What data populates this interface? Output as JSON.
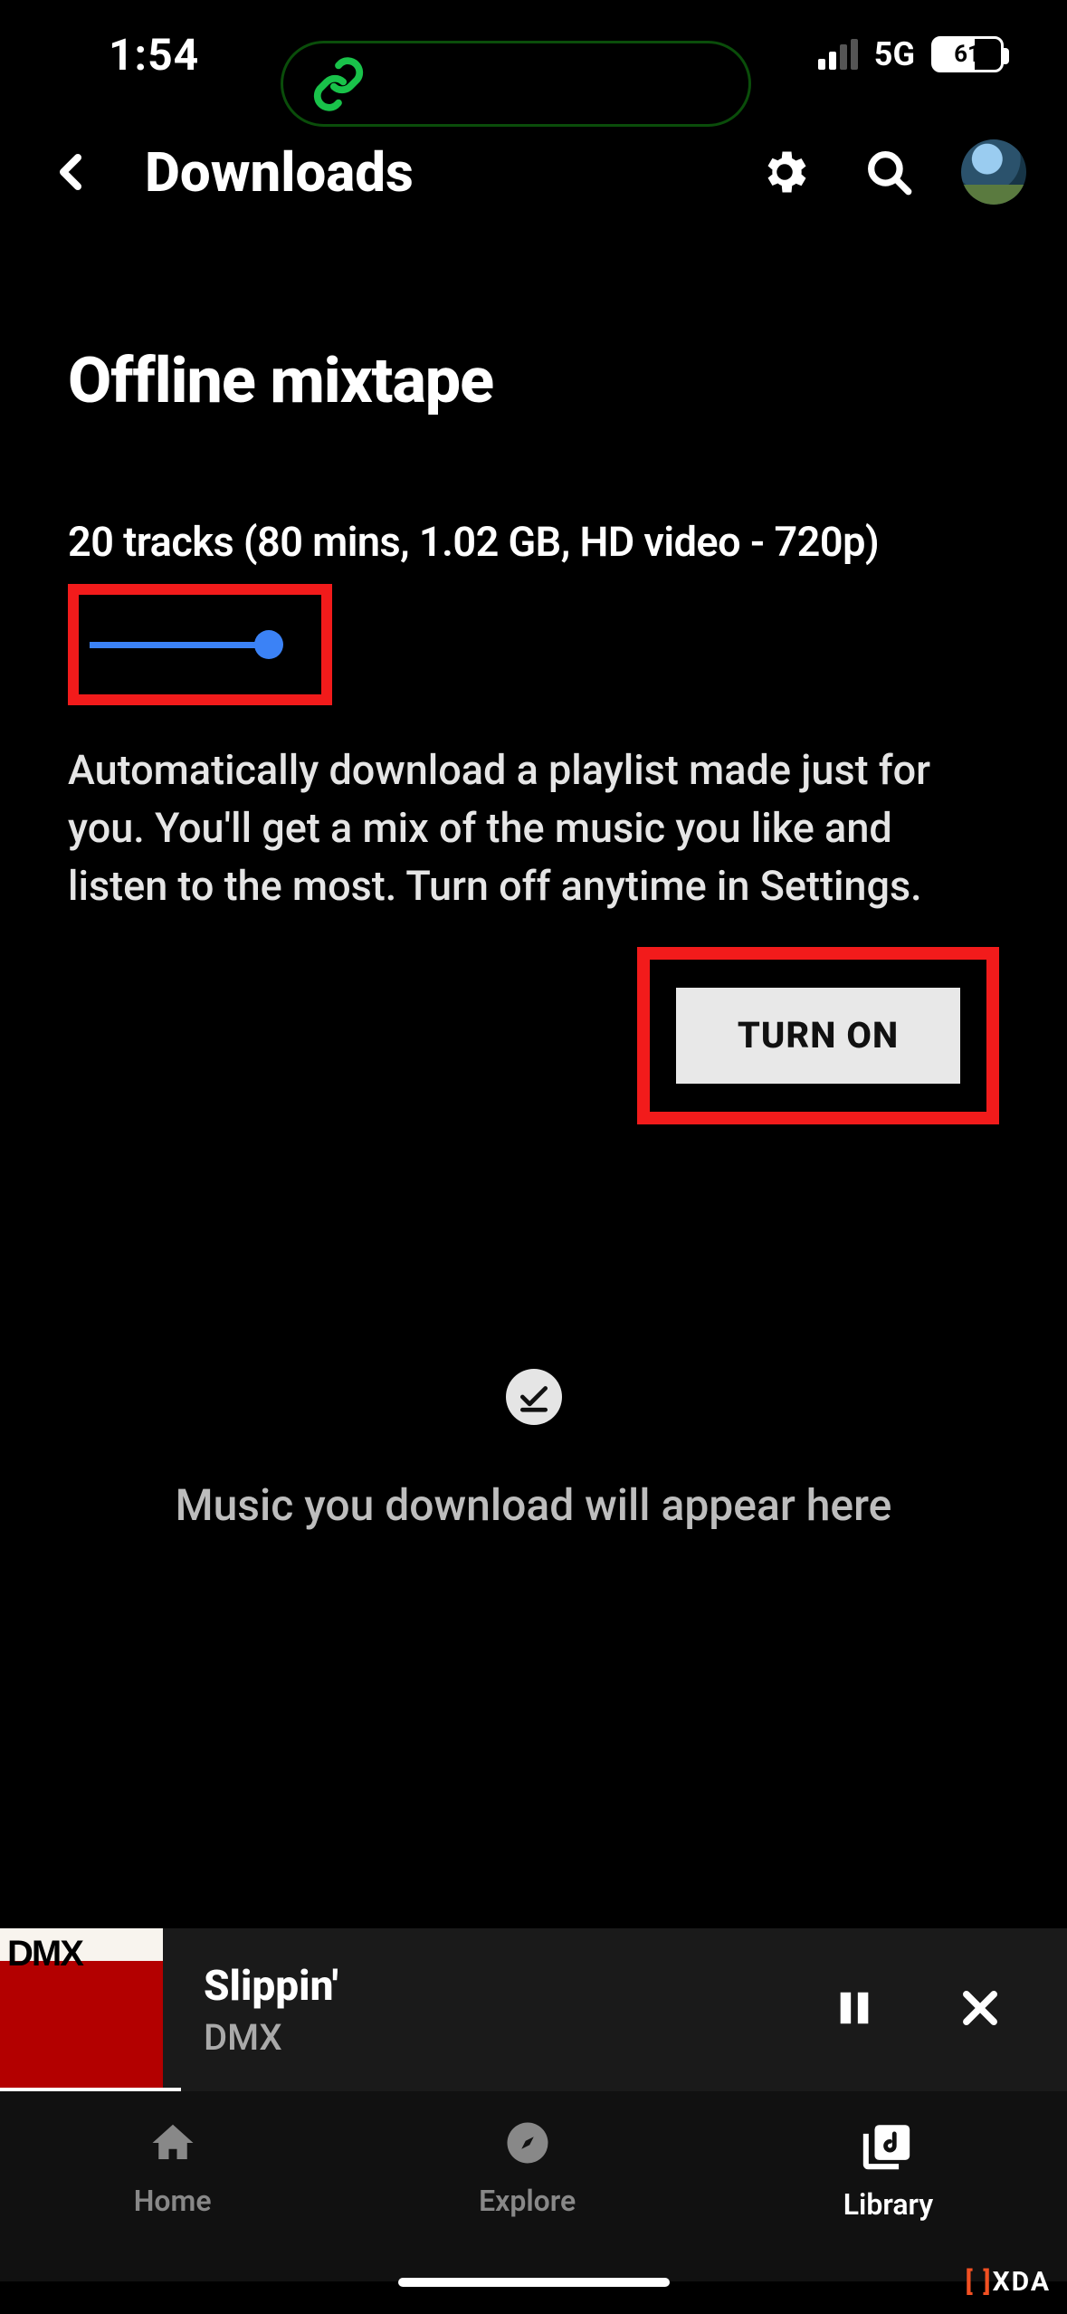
{
  "status": {
    "time": "1:54",
    "network": "5G",
    "battery_pct": "61"
  },
  "header": {
    "title": "Downloads"
  },
  "mixtape": {
    "title": "Offline mixtape",
    "summary": "20 tracks (80 mins, 1.02 GB, HD video - 720p)",
    "description": "Automatically download a playlist made just for you. You'll get a mix of the music you like and listen to the most. Turn off anytime in Settings.",
    "button_label": "TURN ON"
  },
  "empty": {
    "message": "Music you download will appear here"
  },
  "player": {
    "track_title": "Slippin'",
    "artist": "DMX",
    "album_art_text": "DMX"
  },
  "nav": {
    "home": "Home",
    "explore": "Explore",
    "library": "Library",
    "active": "library"
  },
  "watermark": "XDA",
  "colors": {
    "highlight": "#f21b1b",
    "slider": "#3b82f6"
  }
}
